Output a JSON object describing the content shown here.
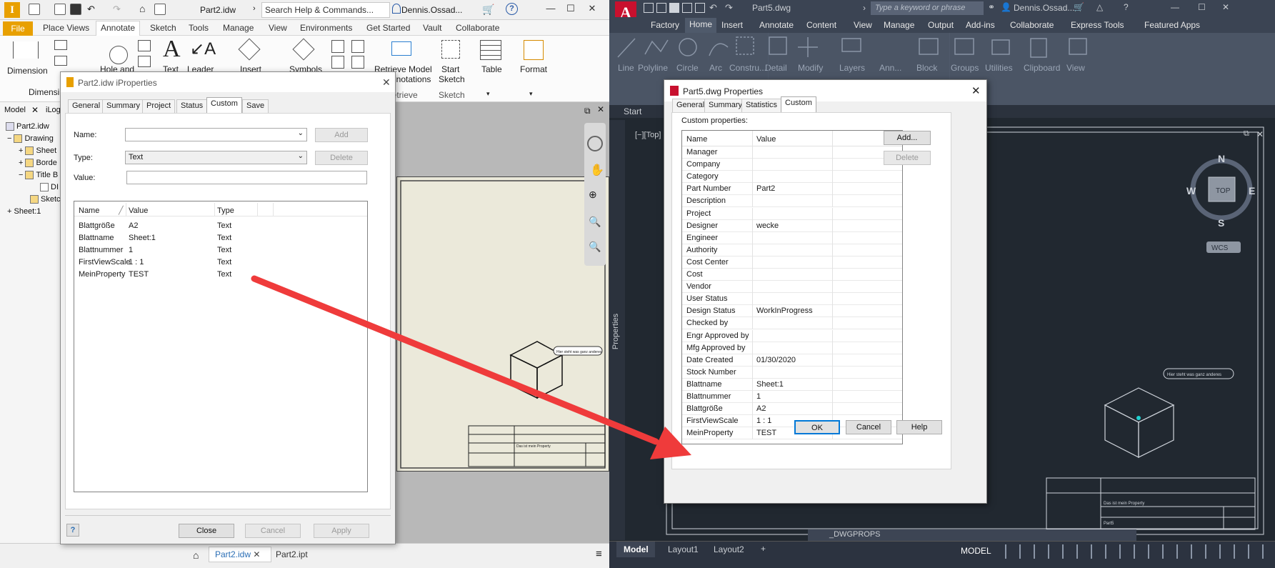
{
  "inventor": {
    "doc_title": "Part2.idw",
    "search_placeholder": "Search Help & Commands...",
    "user": "Dennis.Ossad...",
    "menu": {
      "file": "File",
      "tabs": [
        "Place Views",
        "Annotate",
        "Sketch",
        "Tools",
        "Manage",
        "View",
        "Environments",
        "Get Started",
        "Vault",
        "Collaborate"
      ]
    },
    "ribbon": {
      "dimension": "Dimension",
      "hole_and": "Hole and",
      "text": "Text",
      "leader": "Leader",
      "insert": "Insert",
      "symbols": "Symbols",
      "retrieve_model": "Retrieve Model",
      "annotations": "Annotations",
      "retrieve": "Retrieve",
      "start": "Start",
      "sketch": "Sketch",
      "sketch_panel": "Sketch",
      "table": "Table",
      "format": "Format",
      "dimension_panel": "Dimensi"
    },
    "browser": {
      "tabs": [
        "Model",
        "iLog"
      ],
      "items": [
        "Part2.idw",
        "Drawing",
        "Sheet",
        "Borde",
        "Title B",
        "DI",
        "Sketc",
        "Sheet:1"
      ]
    },
    "bottom_tabs": [
      "Part2.idw",
      "Part2.ipt"
    ],
    "drawing_note": "Hier steht was ganz anderes",
    "title_block_note": "Das ist mein Property"
  },
  "iprops_dialog": {
    "title": "Part2.idw iProperties",
    "tabs": [
      "General",
      "Summary",
      "Project",
      "Status",
      "Custom",
      "Save"
    ],
    "active_tab": "Custom",
    "name_label": "Name:",
    "type_label": "Type:",
    "value_label": "Value:",
    "name_value": "",
    "type_value": "Text",
    "value_value": "",
    "add_button": "Add",
    "delete_button": "Delete",
    "columns": [
      "Name",
      "Value",
      "Type"
    ],
    "rows": [
      {
        "name": "Blattgröße",
        "value": "A2",
        "type": "Text"
      },
      {
        "name": "Blattname",
        "value": "Sheet:1",
        "type": "Text"
      },
      {
        "name": "Blattnummer",
        "value": "1",
        "type": "Text"
      },
      {
        "name": "FirstViewScale",
        "value": "1 : 1",
        "type": "Text"
      },
      {
        "name": "MeinProperty",
        "value": "TEST",
        "type": "Text"
      }
    ],
    "close_button": "Close",
    "cancel_button": "Cancel",
    "apply_button": "Apply",
    "help_icon": "?"
  },
  "autocad": {
    "doc_title": "Part5.dwg",
    "search_placeholder": "Type a keyword or phrase",
    "user": "Dennis.Ossad...",
    "tabs": [
      "Factory",
      "Home",
      "Insert",
      "Annotate",
      "Content",
      "View",
      "Manage",
      "Output",
      "Add-ins",
      "Collaborate",
      "Express Tools",
      "Featured Apps"
    ],
    "ribbon_buttons": [
      "Line",
      "Polyline",
      "Circle",
      "Arc",
      "Constru...",
      "Detail",
      "Modify",
      "Layers",
      "Ann...",
      "Block",
      "Groups",
      "Utilities",
      "Clipboard",
      "View"
    ],
    "doc_tabs": [
      "Start"
    ],
    "viewport_label": "[−][Top]",
    "properties_palette": "Properties",
    "viewcube": {
      "n": "N",
      "s": "S",
      "e": "E",
      "w": "W",
      "top": "TOP",
      "wcs": "WCS"
    },
    "drawing_note": "Hier steht was ganz anderes",
    "title_block_note": "Das ist mein Property",
    "title_block_part": "Part5",
    "command_line": "_DWGPROPS",
    "layout_tabs": [
      "Model",
      "Layout1",
      "Layout2"
    ],
    "status_model": "MODEL"
  },
  "dwg_dialog": {
    "title": "Part5.dwg Properties",
    "tabs": [
      "General",
      "Summary",
      "Statistics",
      "Custom"
    ],
    "active_tab": "Custom",
    "custom_props_label": "Custom properties:",
    "columns": [
      "Name",
      "Value"
    ],
    "rows": [
      {
        "name": "Manager",
        "value": ""
      },
      {
        "name": "Company",
        "value": ""
      },
      {
        "name": "Category",
        "value": ""
      },
      {
        "name": "Part Number",
        "value": "Part2"
      },
      {
        "name": "Description",
        "value": ""
      },
      {
        "name": "Project",
        "value": ""
      },
      {
        "name": "Designer",
        "value": "wecke"
      },
      {
        "name": "Engineer",
        "value": ""
      },
      {
        "name": "Authority",
        "value": ""
      },
      {
        "name": "Cost Center",
        "value": ""
      },
      {
        "name": "Cost",
        "value": ""
      },
      {
        "name": "Vendor",
        "value": ""
      },
      {
        "name": "User Status",
        "value": ""
      },
      {
        "name": "Design Status",
        "value": "WorkInProgress"
      },
      {
        "name": "Checked by",
        "value": ""
      },
      {
        "name": "Engr Approved by",
        "value": ""
      },
      {
        "name": "Mfg Approved by",
        "value": ""
      },
      {
        "name": "Date Created",
        "value": "01/30/2020"
      },
      {
        "name": "Stock Number",
        "value": ""
      },
      {
        "name": "Blattname",
        "value": "Sheet:1"
      },
      {
        "name": "Blattnummer",
        "value": "1"
      },
      {
        "name": "Blattgröße",
        "value": "A2"
      },
      {
        "name": "FirstViewScale",
        "value": "1 : 1"
      },
      {
        "name": "MeinProperty",
        "value": "TEST"
      }
    ],
    "add_button": "Add...",
    "delete_button": "Delete",
    "ok_button": "OK",
    "cancel_button": "Cancel",
    "help_button": "Help"
  },
  "colors": {
    "arrow": "#ef3b3b",
    "inventor_accent": "#e8a000",
    "autocad_red": "#c8102e",
    "autocad_bg": "#212830"
  }
}
